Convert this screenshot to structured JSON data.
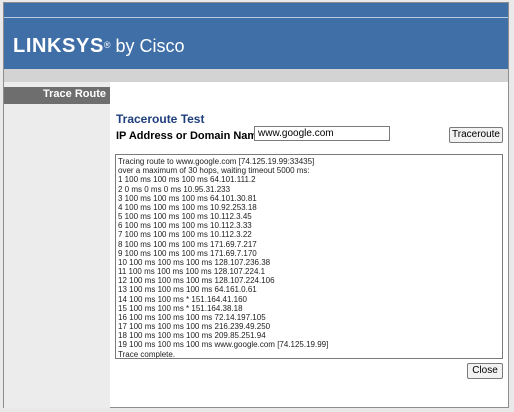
{
  "header": {
    "brand": "LINKSYS",
    "reg_mark": "®",
    "by_text": "by Cisco"
  },
  "sidebar": {
    "active_item": "Trace Route"
  },
  "main": {
    "title": "Traceroute Test",
    "ip_label": "IP Address or Domain Name:",
    "ip_value": "www.google.com",
    "traceroute_button": "Traceroute",
    "close_button": "Close",
    "output_lines": [
      "Tracing route to www.google.com [74.125.19.99:33435]",
      "over a maximum of 30 hops, waiting timeout 5000 ms:",
      "1 100 ms 100 ms 100 ms 64.101.111.2",
      "2 0 ms 0 ms 0 ms 10.95.31.233",
      "3 100 ms 100 ms 100 ms 64.101.30.81",
      "4 100 ms 100 ms 100 ms 10.92.253.18",
      "5 100 ms 100 ms 100 ms 10.112.3.45",
      "6 100 ms 100 ms 100 ms 10.112.3.33",
      "7 100 ms 100 ms 100 ms 10.112.3.22",
      "8 100 ms 100 ms 100 ms 171.69.7.217",
      "9 100 ms 100 ms 100 ms 171.69.7.170",
      "10 100 ms 100 ms 100 ms 128.107.236.38",
      "11 100 ms 100 ms 100 ms 128.107.224.1",
      "12 100 ms 100 ms 100 ms 128.107.224.106",
      "13 100 ms 100 ms 100 ms 64.161.0.61",
      "14 100 ms 100 ms * 151.164.41.160",
      "15 100 ms 100 ms * 151.164.38.18",
      "16 100 ms 100 ms 100 ms 72.14.197.105",
      "17 100 ms 100 ms 100 ms 216.239.49.250",
      "18 100 ms 100 ms 100 ms 209.85.251.94",
      "19 100 ms 100 ms 100 ms www.google.com [74.125.19.99]",
      "Trace complete."
    ]
  },
  "colors": {
    "header_blue": "#3f6fa6",
    "title_blue": "#1f3e7c",
    "sidebar_active": "#6e6e6e",
    "sidebar_bg": "#ececec"
  }
}
